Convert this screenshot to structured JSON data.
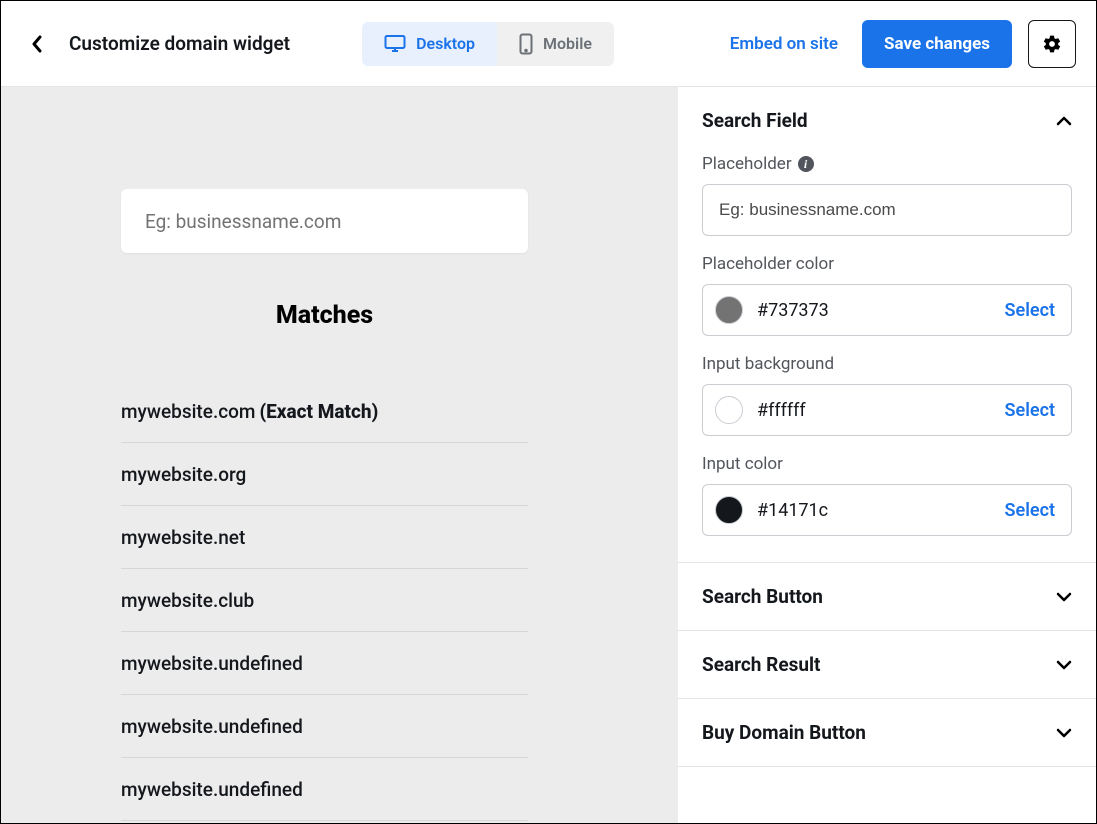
{
  "header": {
    "title": "Customize domain widget",
    "tabs": {
      "desktop": "Desktop",
      "mobile": "Mobile"
    },
    "embed_link": "Embed on site",
    "save_label": "Save changes"
  },
  "preview": {
    "placeholder": "Eg: businessname.com",
    "matches_heading": "Matches",
    "results": [
      {
        "domain": "mywebsite.com",
        "exact_tag": "(Exact Match)"
      },
      {
        "domain": "mywebsite.org"
      },
      {
        "domain": "mywebsite.net"
      },
      {
        "domain": "mywebsite.club"
      },
      {
        "domain": "mywebsite.undefined"
      },
      {
        "domain": "mywebsite.undefined"
      },
      {
        "domain": "mywebsite.undefined"
      }
    ]
  },
  "sidebar": {
    "search_field": {
      "title": "Search Field",
      "placeholder_label": "Placeholder",
      "placeholder_value": "Eg: businessname.com",
      "placeholder_color_label": "Placeholder color",
      "placeholder_color_value": "#737373",
      "input_bg_label": "Input background",
      "input_bg_value": "#ffffff",
      "input_color_label": "Input color",
      "input_color_value": "#14171c",
      "select_label": "Select"
    },
    "sections": {
      "search_button": "Search Button",
      "search_result": "Search Result",
      "buy_domain": "Buy Domain Button"
    }
  }
}
